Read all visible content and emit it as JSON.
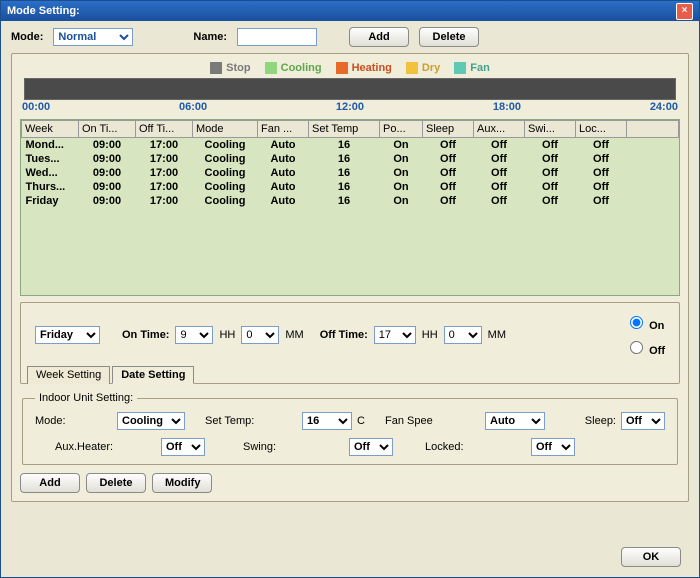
{
  "title": "Mode Setting:",
  "top": {
    "mode_label": "Mode:",
    "mode_value": "Normal",
    "name_label": "Name:",
    "name_value": "",
    "add": "Add",
    "delete": "Delete"
  },
  "legend": {
    "stop": {
      "label": "Stop",
      "color": "#7a7a7a"
    },
    "cooling": {
      "label": "Cooling",
      "color": "#8fd67d"
    },
    "heating": {
      "label": "Heating",
      "color": "#e86a2b"
    },
    "dry": {
      "label": "Dry",
      "color": "#f2c23e"
    },
    "fan": {
      "label": "Fan",
      "color": "#5fc9b4"
    }
  },
  "ticks": [
    "00:00",
    "06:00",
    "12:00",
    "18:00",
    "24:00"
  ],
  "table": {
    "headers": [
      "Week",
      "On Ti...",
      "Off Ti...",
      "Mode",
      "Fan ...",
      "Set Temp",
      "Po...",
      "Sleep",
      "Aux...",
      "Swi...",
      "Loc..."
    ],
    "rows": [
      [
        "Mond...",
        "09:00",
        "17:00",
        "Cooling",
        "Auto",
        "16",
        "On",
        "Off",
        "Off",
        "Off",
        "Off"
      ],
      [
        "Tues...",
        "09:00",
        "17:00",
        "Cooling",
        "Auto",
        "16",
        "On",
        "Off",
        "Off",
        "Off",
        "Off"
      ],
      [
        "Wed...",
        "09:00",
        "17:00",
        "Cooling",
        "Auto",
        "16",
        "On",
        "Off",
        "Off",
        "Off",
        "Off"
      ],
      [
        "Thurs...",
        "09:00",
        "17:00",
        "Cooling",
        "Auto",
        "16",
        "On",
        "Off",
        "Off",
        "Off",
        "Off"
      ],
      [
        "Friday",
        "09:00",
        "17:00",
        "Cooling",
        "Auto",
        "16",
        "On",
        "Off",
        "Off",
        "Off",
        "Off"
      ]
    ]
  },
  "week_setting": {
    "day": "Friday",
    "on_label": "On Time:",
    "on_h": "9",
    "on_m": "0",
    "hh": "HH",
    "mm": "MM",
    "off_label": "Off Time:",
    "off_h": "17",
    "off_m": "0",
    "radio_on": "On",
    "radio_off": "Off",
    "tab_week": "Week Setting",
    "tab_date": "Date Setting"
  },
  "indoor": {
    "legend": "Indoor Unit Setting:",
    "mode_label": "Mode:",
    "mode_value": "Cooling",
    "temp_label": "Set Temp:",
    "temp_value": "16",
    "temp_unit": "C",
    "fan_label": "Fan Spee",
    "fan_value": "Auto",
    "sleep_label": "Sleep:",
    "sleep_value": "Off",
    "aux_label": "Aux.Heater:",
    "aux_value": "Off",
    "swing_label": "Swing:",
    "swing_value": "Off",
    "locked_label": "Locked:",
    "locked_value": "Off"
  },
  "actions": {
    "add": "Add",
    "delete": "Delete",
    "modify": "Modify",
    "ok": "OK"
  }
}
